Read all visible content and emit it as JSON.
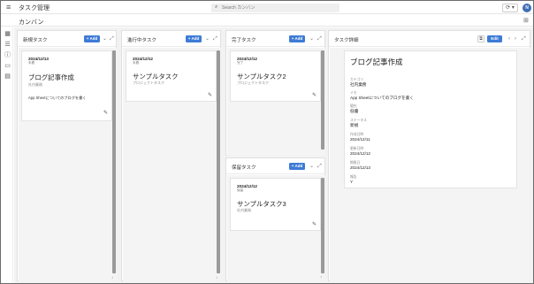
{
  "app": {
    "title": "タスク管理"
  },
  "search": {
    "placeholder": "Search カンバン"
  },
  "header": {
    "sync_icon": "sync-icon",
    "sync_label": "⟳ ▾",
    "avatar_initial": "N",
    "avatar_color": "#3c6fb7"
  },
  "page": {
    "title": "カンバン"
  },
  "lanes": [
    {
      "title": "新規タスク",
      "add_label": "+ Add",
      "card": {
        "date": "2024/12/13",
        "status": "未着",
        "title": "ブログ記事作成",
        "sub": "社内業務",
        "desc": "App Sheetについてのブログを書く"
      }
    },
    {
      "title": "進行中タスク",
      "add_label": "+ Add",
      "card": {
        "date": "2024/12/12",
        "status": "未着",
        "title": "サンプルタスク",
        "sub": "プロジェクトタスク"
      }
    },
    {
      "title": "完了タスク",
      "add_label": "+ Add",
      "card": {
        "date": "2024/12/12",
        "status": "完了",
        "title": "サンプルタスク2",
        "sub": "プロジェクトタスク"
      }
    },
    {
      "title": "保留タスク",
      "add_label": "+ Add",
      "card": {
        "date": "2024/12/12",
        "status": "保留",
        "title": "サンプルタスク3",
        "sub": "社内業務"
      }
    }
  ],
  "detail": {
    "panel_title": "タスク詳細",
    "edit_label": "Edit",
    "title": "ブログ記事作成",
    "fields": [
      {
        "label": "カテゴリ",
        "value": "社内業務"
      },
      {
        "label": "メモ",
        "value": "App Sheetについてのブログを書く"
      },
      {
        "label": "優先",
        "value": "低優"
      },
      {
        "label": "ステータス",
        "value": "新規"
      },
      {
        "label": "作成日時",
        "value": "2024/12/11"
      },
      {
        "label": "更新日時",
        "value": "2024/12/12"
      },
      {
        "label": "期限日",
        "value": "2024/12/13"
      },
      {
        "label": "報告",
        "value": "Y"
      }
    ]
  },
  "accent_color": "#3d7bd6"
}
